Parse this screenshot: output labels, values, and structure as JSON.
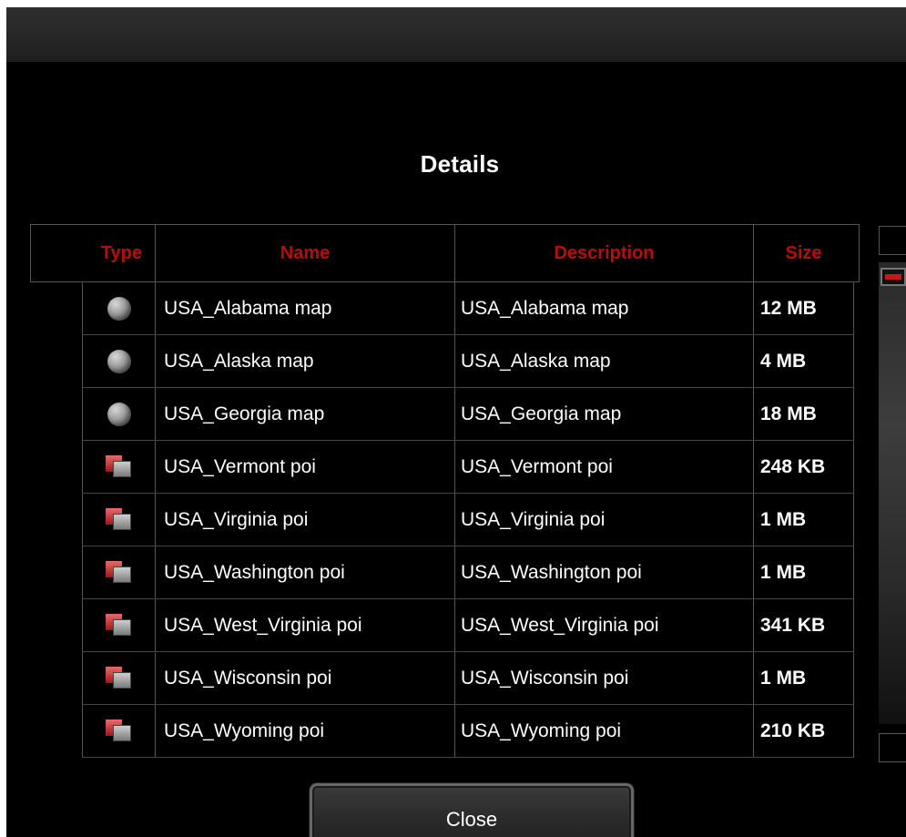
{
  "dialog": {
    "title": "Details",
    "close_label": "Close"
  },
  "table": {
    "headers": {
      "type": "Type",
      "name": "Name",
      "description": "Description",
      "size": "Size"
    },
    "rows": [
      {
        "type_icon": "globe-map-icon",
        "name": "USA_Alabama map",
        "description": "USA_Alabama map",
        "size": "12 MB"
      },
      {
        "type_icon": "globe-map-icon",
        "name": "USA_Alaska map",
        "description": "USA_Alaska map",
        "size": "4 MB"
      },
      {
        "type_icon": "globe-map-icon",
        "name": "USA_Georgia map",
        "description": "USA_Georgia map",
        "size": "18 MB"
      },
      {
        "type_icon": "poi-icon",
        "name": "USA_Vermont poi",
        "description": "USA_Vermont poi",
        "size": "248 KB"
      },
      {
        "type_icon": "poi-icon",
        "name": "USA_Virginia poi",
        "description": "USA_Virginia poi",
        "size": "1 MB"
      },
      {
        "type_icon": "poi-icon",
        "name": "USA_Washington poi",
        "description": "USA_Washington poi",
        "size": "1 MB"
      },
      {
        "type_icon": "poi-icon",
        "name": "USA_West_Virginia poi",
        "description": "USA_West_Virginia poi",
        "size": "341 KB"
      },
      {
        "type_icon": "poi-icon",
        "name": "USA_Wisconsin poi",
        "description": "USA_Wisconsin poi",
        "size": "1 MB"
      },
      {
        "type_icon": "poi-icon",
        "name": "USA_Wyoming poi",
        "description": "USA_Wyoming poi",
        "size": "210 KB"
      }
    ]
  },
  "colors": {
    "header_text": "#b90d0d",
    "background": "#000000",
    "scroll_thumb_accent": "#c51a1a"
  }
}
